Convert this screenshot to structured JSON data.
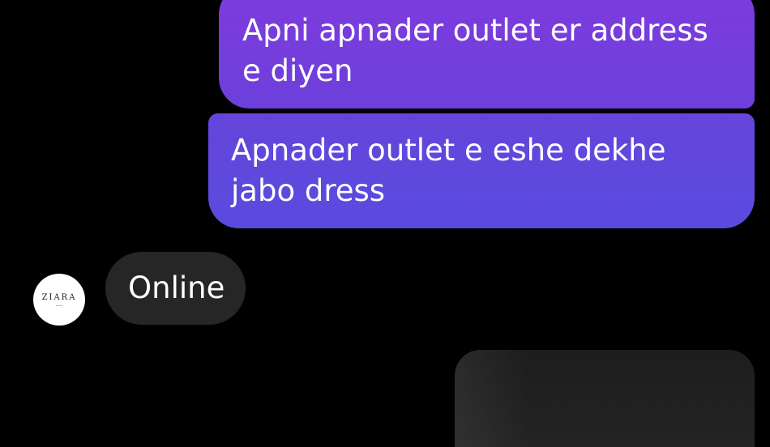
{
  "messages": [
    {
      "direction": "sent",
      "text": "Apni apnader outlet er address e diyen"
    },
    {
      "direction": "sent",
      "text": "Apnader outlet e eshe dekhe jabo dress"
    },
    {
      "direction": "received",
      "text": "Online"
    }
  ],
  "avatar": {
    "logo_text": "ZIARA"
  },
  "colors": {
    "background": "#000000",
    "sent_bubble_top": "#7e3bdc",
    "sent_bubble_bottom": "#5a4bde",
    "received_bubble": "#262626",
    "text": "#ffffff"
  }
}
